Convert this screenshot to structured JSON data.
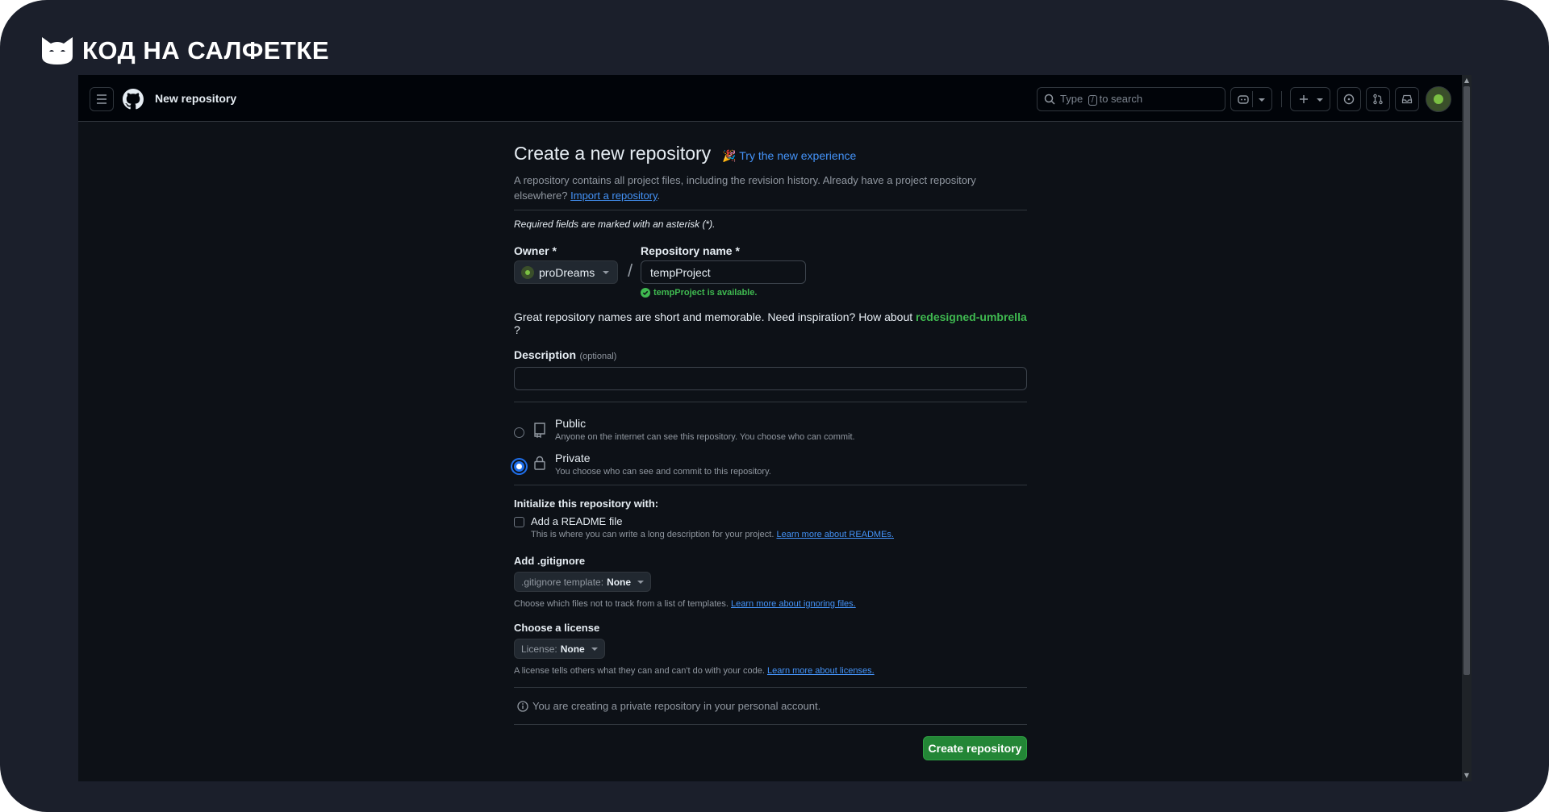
{
  "brand": {
    "name": "КОД НА САЛФЕТКЕ"
  },
  "header": {
    "title": "New repository",
    "search_prefix": "Type",
    "search_key": "/",
    "search_suffix": "to search"
  },
  "page": {
    "title": "Create a new repository",
    "try_link": "Try the new experience",
    "intro": "A repository contains all project files, including the revision history. Already have a project repository elsewhere?",
    "import_link": "Import a repository",
    "required_note": "Required fields are marked with an asterisk (*).",
    "owner_label": "Owner *",
    "owner_value": "proDreams",
    "repo_label": "Repository name *",
    "repo_value": "tempProject",
    "available_msg": "tempProject is available.",
    "inspiration_text": "Great repository names are short and memorable. Need inspiration? How about",
    "suggestion": "redesigned-umbrella",
    "suggestion_suffix": "?",
    "description_label": "Description",
    "description_optional": "(optional)",
    "description_value": "",
    "public_label": "Public",
    "public_desc": "Anyone on the internet can see this repository. You choose who can commit.",
    "private_label": "Private",
    "private_desc": "You choose who can see and commit to this repository.",
    "visibility_selected": "Private",
    "init_label": "Initialize this repository with:",
    "readme_label": "Add a README file",
    "readme_desc": "This is where you can write a long description for your project.",
    "readme_link": "Learn more about READMEs.",
    "gitignore_label": "Add .gitignore",
    "gitignore_select_prefix": ".gitignore template:",
    "gitignore_select_value": "None",
    "gitignore_desc": "Choose which files not to track from a list of templates.",
    "gitignore_link": "Learn more about ignoring files.",
    "license_label": "Choose a license",
    "license_select_prefix": "License:",
    "license_select_value": "None",
    "license_desc": "A license tells others what they can and can't do with your code.",
    "license_link": "Learn more about licenses.",
    "info_note": "You are creating a private repository in your personal account.",
    "create_button": "Create repository"
  },
  "colors": {
    "accent": "#4493f8",
    "success": "#3fb950",
    "primary_button": "#238636",
    "background": "#0d1117"
  },
  "icons": [
    "cat-logo-icon",
    "hamburger-icon",
    "github-logo-icon",
    "search-icon",
    "copilot-icon",
    "plus-icon",
    "issues-icon",
    "pull-requests-icon",
    "inbox-icon",
    "avatar",
    "repo-icon",
    "lock-icon",
    "check-circle-icon",
    "info-icon"
  ]
}
